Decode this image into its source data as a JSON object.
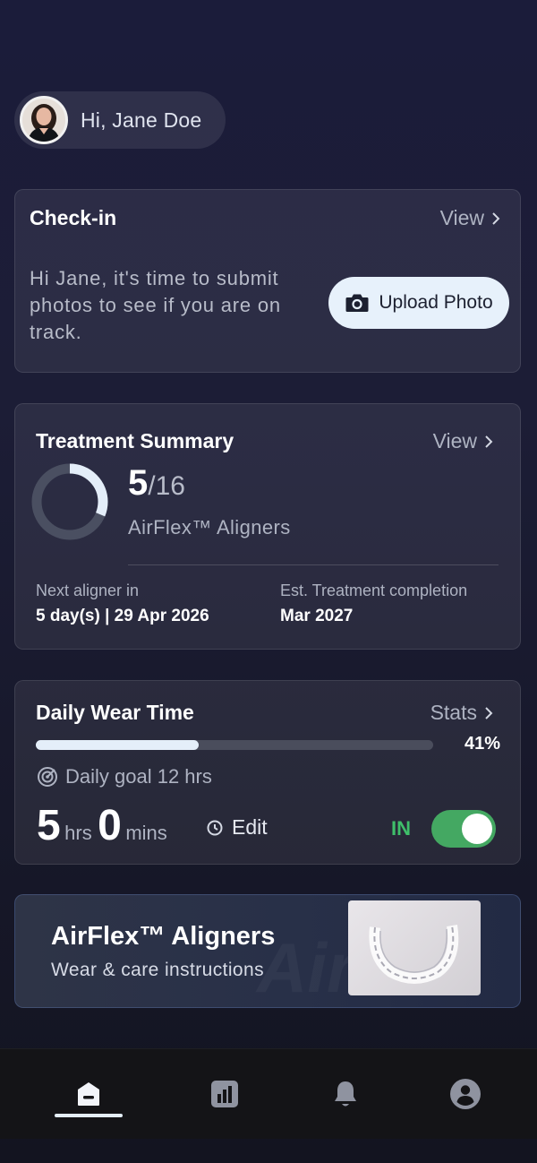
{
  "greeting": {
    "text": "Hi, Jane Doe"
  },
  "checkin": {
    "title": "Check-in",
    "view_label": "View",
    "message": "Hi Jane, it's time to submit photos to see if you are on track.",
    "upload_label": "Upload Photo"
  },
  "treatment": {
    "title": "Treatment Summary",
    "view_label": "View",
    "current": "5",
    "total": "/16",
    "progress_fraction": 0.3125,
    "product": "AirFlex™ Aligners",
    "next_label": "Next aligner in",
    "next_value": "5 day(s) | 29 Apr 2026",
    "completion_label": "Est. Treatment completion",
    "completion_value": "Mar 2027"
  },
  "wear": {
    "title": "Daily Wear Time",
    "stats_label": "Stats",
    "percent_label": "41%",
    "percent_value": 41,
    "goal": "Daily goal 12 hrs",
    "hours": "5",
    "hours_unit": "hrs",
    "mins": "0",
    "mins_unit": "mins",
    "edit_label": "Edit",
    "status": "IN",
    "toggle_on": true
  },
  "promo": {
    "title": "AirFlex™ Aligners",
    "subtitle": "Wear & care instructions"
  },
  "nav": {
    "items": [
      {
        "icon": "home-icon",
        "active": true
      },
      {
        "icon": "stats-icon",
        "active": false
      },
      {
        "icon": "bell-icon",
        "active": false
      },
      {
        "icon": "profile-icon",
        "active": false
      }
    ]
  },
  "colors": {
    "accent_green": "#44a862",
    "status_green": "#3fbf6a",
    "progress_fill": "#e4eef9"
  }
}
